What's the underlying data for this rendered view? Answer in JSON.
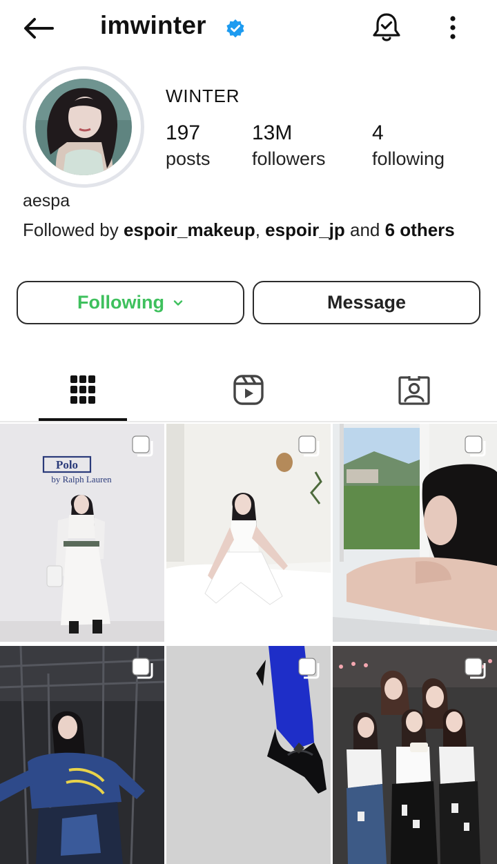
{
  "header": {
    "username": "imwinter",
    "back_icon": "arrow-left-icon",
    "verified_icon": "verified-badge-icon",
    "notifications_icon": "bell-check-icon",
    "more_icon": "more-vertical-icon",
    "verified_color": "#1d9bf0"
  },
  "profile": {
    "display_name": "WINTER",
    "stats": {
      "posts_count": "197",
      "posts_label": "posts",
      "followers_count": "13M",
      "followers_label": "followers",
      "following_count": "4",
      "following_label": "following"
    },
    "bio": "aespa",
    "followed_by": {
      "prefix": "Followed by ",
      "user1": "espoir_makeup",
      "separator": ", ",
      "user2": "espoir_jp",
      "conjunction": " and ",
      "others": "6 others"
    }
  },
  "actions": {
    "following_label": "Following",
    "following_color": "#3ec05d",
    "message_label": "Message"
  },
  "tabs": [
    {
      "name": "posts-grid",
      "icon": "grid-icon",
      "active": true
    },
    {
      "name": "reels",
      "icon": "reels-icon",
      "active": false
    },
    {
      "name": "tagged",
      "icon": "tagged-person-icon",
      "active": false
    }
  ],
  "posts": [
    {
      "description": "Polo Ralph Lauren event, white outfit",
      "carousel": true
    },
    {
      "description": "Sitting on white bed",
      "carousel": true
    },
    {
      "description": "Resting by window",
      "carousel": true
    },
    {
      "description": "Stand Vintage blue top",
      "carousel": true
    },
    {
      "description": "Black heel with blue tights",
      "carousel": true
    },
    {
      "description": "Group photo on stage",
      "carousel": true
    }
  ],
  "post_texts": {
    "polo_logo": "Polo",
    "polo_sub": "by Ralph Lauren"
  }
}
